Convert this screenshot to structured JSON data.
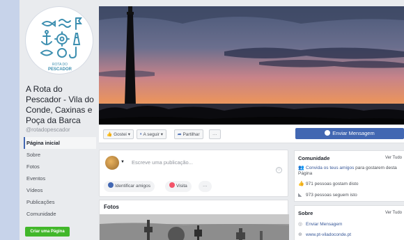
{
  "page": {
    "name": "A Rota do Pescador - Vila do Conde, Caxinas e Poça da Barca",
    "handle": "@rotadopescador",
    "logo_text": [
      "ROTA DO",
      "PESCADOR"
    ]
  },
  "nav": [
    {
      "label": "Página inicial",
      "active": true
    },
    {
      "label": "Sobre"
    },
    {
      "label": "Fotos"
    },
    {
      "label": "Eventos"
    },
    {
      "label": "Vídeos"
    },
    {
      "label": "Publicações"
    },
    {
      "label": "Comunidade"
    }
  ],
  "create_page_label": "Criar uma Página",
  "actions": {
    "like": "Gostei",
    "follow": "A seguir",
    "share": "Partilhar",
    "more": "···",
    "send_message": "Enviar Mensagem"
  },
  "composer": {
    "placeholder": "Escreve uma publicação...",
    "tag_friends": "Identificar amigos",
    "visit": "Visita",
    "more": "···"
  },
  "photos": {
    "title": "Fotos"
  },
  "community": {
    "title": "Comunidade",
    "see_all": "Ver Tudo",
    "invite_link": "Convida os teus amigos",
    "invite_rest": " para gostarem desta Página",
    "likes": "971 pessoas gostam disto",
    "follows": "973 pessoas seguem isto"
  },
  "about": {
    "title": "Sobre",
    "see_all": "Ver Tudo",
    "send_message": "Enviar Mensagem",
    "website": "www.pt-viladoconde.pt"
  },
  "colors": {
    "brand_blue": "#4267b2",
    "create_green": "#42b72a",
    "logo_teal": "#3d8fb0"
  },
  "icons": [
    "thumbs-up-icon",
    "rss-icon",
    "share-icon",
    "messenger-icon",
    "smile-icon",
    "tag-friends-icon",
    "location-pin-icon",
    "people-icon",
    "mail-icon",
    "globe-icon"
  ]
}
